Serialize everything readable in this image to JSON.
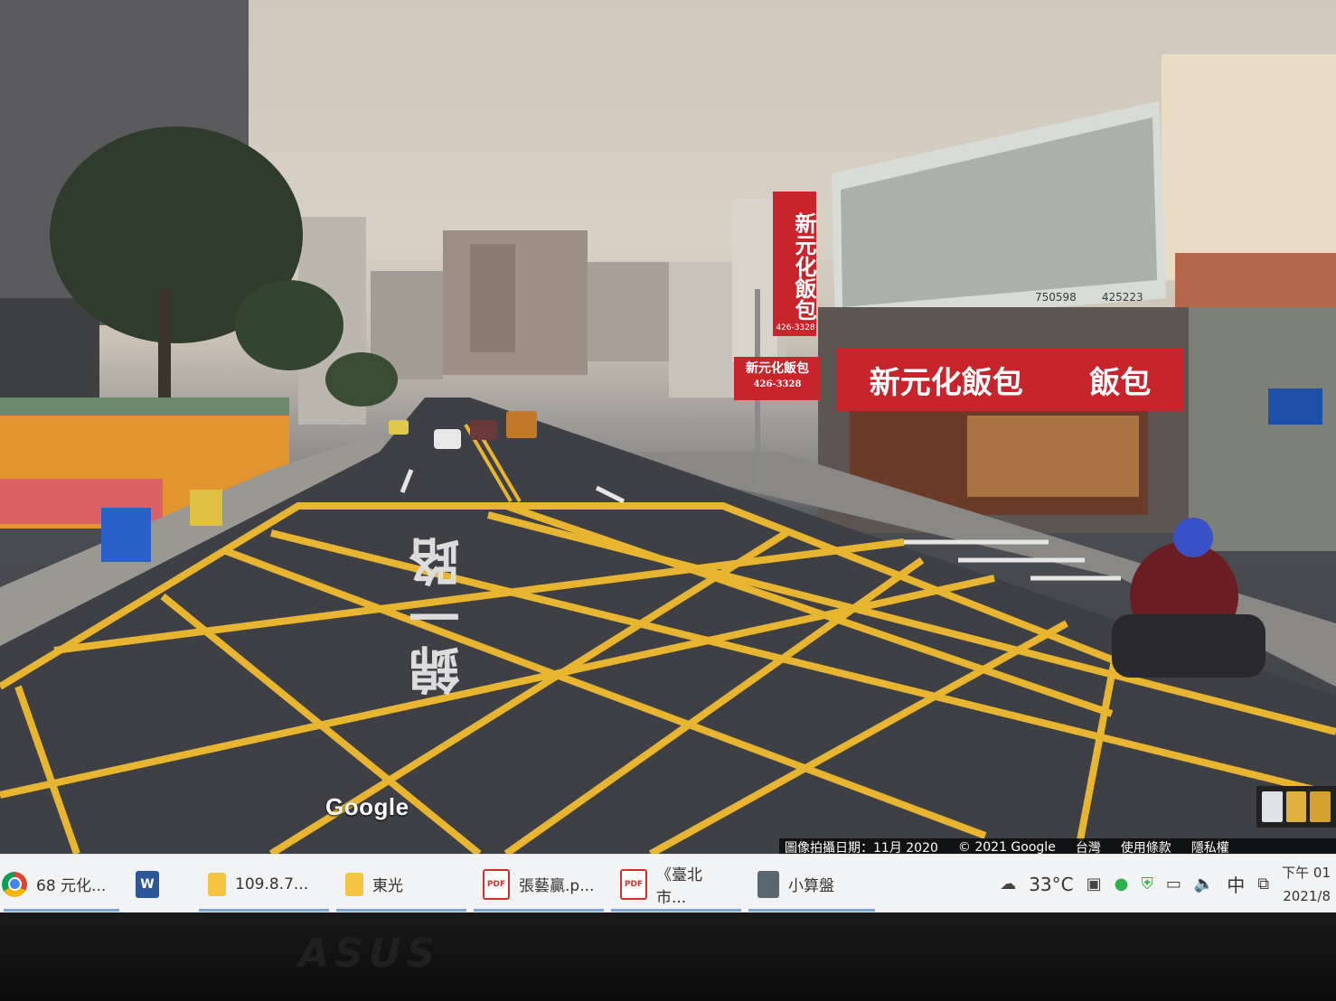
{
  "streetview": {
    "google_logo": "Google",
    "attribution": {
      "capture_date": "圖像拍攝日期：11月 2020",
      "copyright": "© 2021 Google",
      "region": "台灣",
      "terms": "使用條款",
      "privacy": "隱私權"
    },
    "scene": {
      "road_marking": "錦一路",
      "shop_sign_vertical": "新元化飯包",
      "shop_sign_main": "新元化飯包",
      "shop_sign_right": "飯包",
      "shop_sign_left": "新元化飯包",
      "phone_vertical": "426-3328",
      "phone_left": "426-3328",
      "billboard_phone_1": "750598",
      "billboard_phone_2": "425223"
    },
    "colors": {
      "road_lines": "#e8b530",
      "sign_red": "#c8242c"
    }
  },
  "taskbar": {
    "apps": [
      {
        "icon": "chrome-icon",
        "label": "68 元化..."
      },
      {
        "icon": "word-icon",
        "label": ""
      },
      {
        "icon": "folder-icon",
        "label": "109.8.7..."
      },
      {
        "icon": "folder-icon",
        "label": "東光"
      },
      {
        "icon": "pdf-icon",
        "label": "張藝贏.p..."
      },
      {
        "icon": "pdf-icon",
        "label": "《臺北市..."
      },
      {
        "icon": "calculator-icon",
        "label": "小算盤"
      }
    ],
    "tray": {
      "temperature": "33°C",
      "ime": "中",
      "time": "下午 01",
      "date": "2021/8"
    }
  },
  "bezel": {
    "brand": "ASUS"
  }
}
